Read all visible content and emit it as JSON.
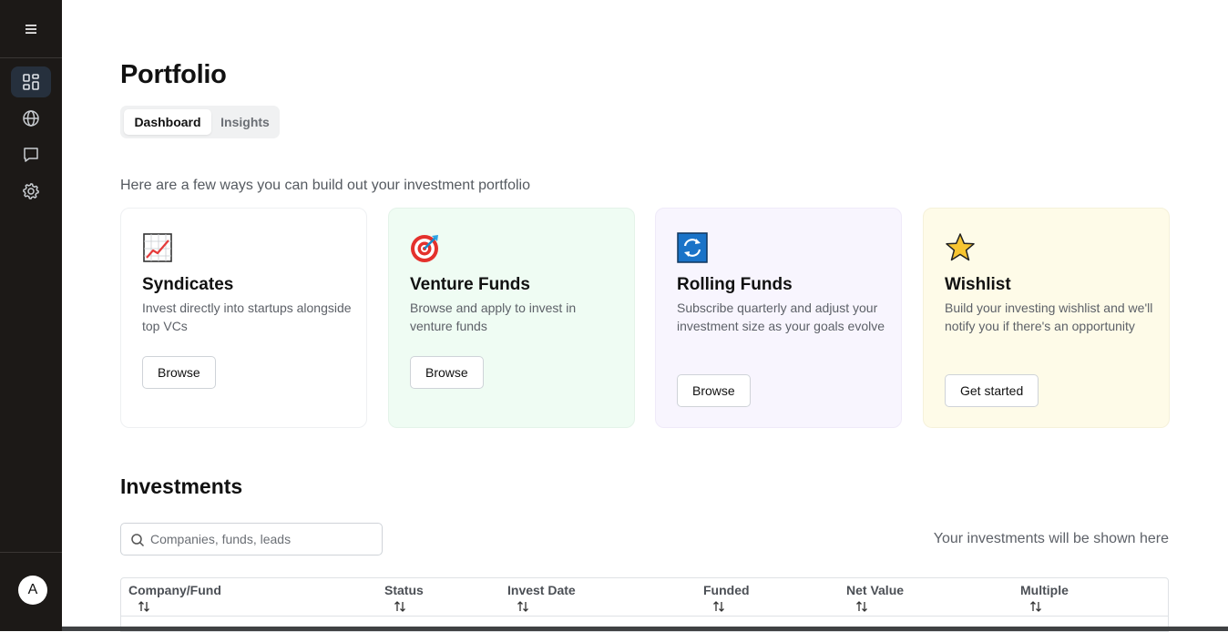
{
  "sidebar": {
    "items": [
      {
        "name": "dashboard",
        "icon": "grid-icon",
        "active": true
      },
      {
        "name": "explore",
        "icon": "globe-icon",
        "active": false
      },
      {
        "name": "messages",
        "icon": "chat-icon",
        "active": false
      },
      {
        "name": "settings",
        "icon": "gear-icon",
        "active": false
      }
    ],
    "avatar_letter": "A"
  },
  "page": {
    "title": "Portfolio",
    "tabs": [
      {
        "label": "Dashboard",
        "active": true
      },
      {
        "label": "Insights",
        "active": false
      }
    ],
    "intro": "Here are a few ways you can build out your investment portfolio"
  },
  "cards": [
    {
      "icon": "chart-increasing-icon",
      "title": "Syndicates",
      "description": "Invest directly into startups alongside top VCs",
      "button": "Browse",
      "bg": "#ffffff"
    },
    {
      "icon": "target-icon",
      "title": "Venture Funds",
      "description": "Browse and apply to invest in venture funds",
      "button": "Browse",
      "bg": "#effcf3"
    },
    {
      "icon": "refresh-arrows-icon",
      "title": "Rolling Funds",
      "description": "Subscribe quarterly and adjust your investment size as your goals evolve",
      "button": "Browse",
      "bg": "#f8f5fe"
    },
    {
      "icon": "star-icon",
      "title": "Wishlist",
      "description": "Build your investing wishlist and we'll notify you if there's an opportunity",
      "button": "Get started",
      "bg": "#fefbe8"
    }
  ],
  "investments": {
    "title": "Investments",
    "search_placeholder": "Companies, funds, leads",
    "search_value": "",
    "empty_note": "Your investments will be shown here",
    "columns": [
      "Company/Fund",
      "Status",
      "Invest Date",
      "Funded",
      "Net Value",
      "Multiple"
    ]
  }
}
